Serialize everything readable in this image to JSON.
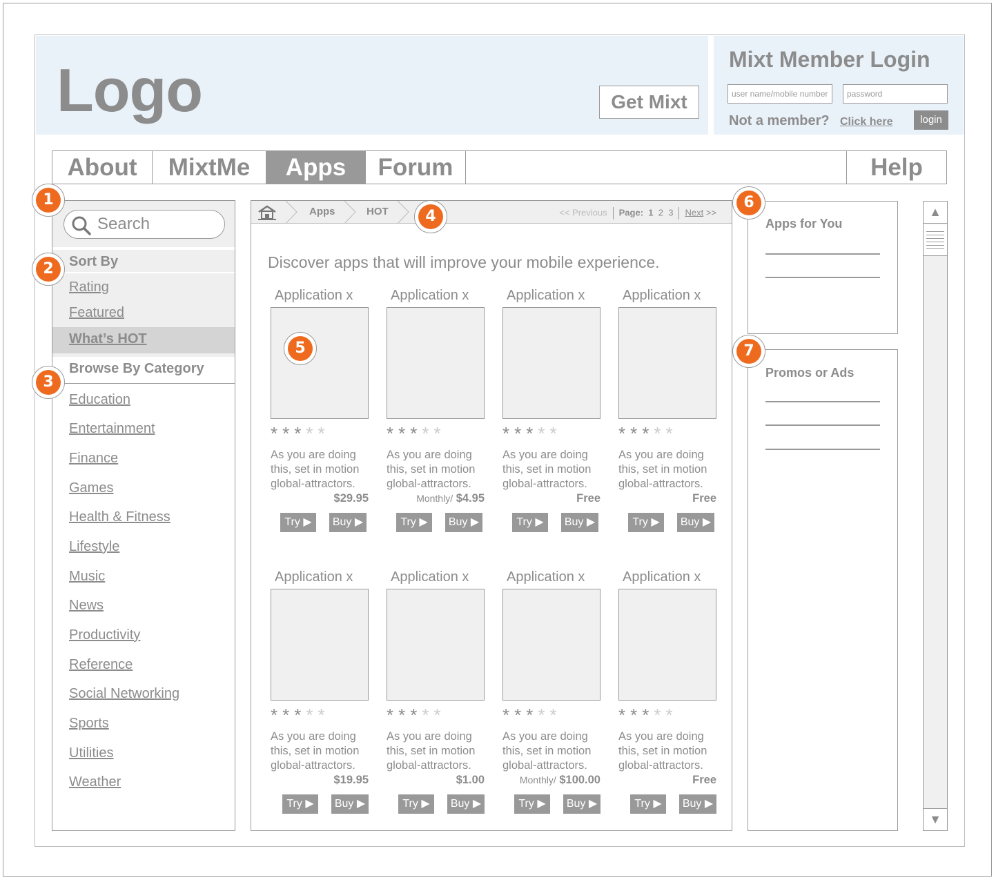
{
  "header": {
    "logo": "Logo",
    "get_mixt": "Get Mixt",
    "login_title": "Mixt Member Login",
    "username_placeholder": "user name/mobile number",
    "password_placeholder": "password",
    "not_member": "Not a member?",
    "click_here": "Click here",
    "login_button": "login"
  },
  "nav": {
    "items": [
      "About",
      "MixtMe",
      "Apps",
      "Forum"
    ],
    "active": "Apps",
    "help": "Help"
  },
  "sidebar": {
    "search_placeholder": "Search",
    "sort_title": "Sort By",
    "sort_items": [
      "Rating",
      "Featured",
      "What’s HOT"
    ],
    "browse_title": "Browse By Category",
    "categories": [
      "Education",
      "Entertainment",
      "Finance",
      "Games",
      "Health & Fitness",
      "Lifestyle",
      "Music",
      "News",
      "Productivity",
      "Reference",
      "Social Networking",
      "Sports",
      "Utilities",
      "Weather"
    ]
  },
  "main": {
    "breadcrumb": [
      "Apps",
      "HOT"
    ],
    "pager": {
      "previous": "<< Previous",
      "page_label": "Page:",
      "current": "1",
      "p2": "2",
      "p3": "3",
      "next": "Next",
      "next_arrows": ">>"
    },
    "intro": "Discover apps that will improve your mobile experience.",
    "apps": [
      {
        "name": "Application x",
        "rating": 3,
        "desc": "As you are doing this, set in motion global-attractors.",
        "price_prefix": "",
        "price": "$29.95",
        "try": "Try ▶",
        "buy": "Buy ▶"
      },
      {
        "name": "Application x",
        "rating": 3,
        "desc": "As you are doing this, set in motion global-attractors.",
        "price_prefix": "Monthly/",
        "price": "$4.95",
        "try": "Try ▶",
        "buy": "Buy ▶"
      },
      {
        "name": "Application x",
        "rating": 3,
        "desc": "As you are doing this, set in motion global-attractors.",
        "price_prefix": "",
        "price": "Free",
        "try": "Try ▶",
        "buy": "Buy ▶"
      },
      {
        "name": "Application x",
        "rating": 3,
        "desc": "As you are doing this, set in motion global-attractors.",
        "price_prefix": "",
        "price": "Free",
        "try": "Try ▶",
        "buy": "Buy ▶"
      },
      {
        "name": "Application x",
        "rating": 3,
        "desc": "As you are doing this, set in motion global-attractors.",
        "price_prefix": "",
        "price": "$19.95",
        "try": "Try ▶",
        "buy": "Buy ▶"
      },
      {
        "name": "Application x",
        "rating": 3,
        "desc": "As you are doing this, set in motion global-attractors.",
        "price_prefix": "",
        "price": "$1.00",
        "try": "Try ▶",
        "buy": "Buy ▶"
      },
      {
        "name": "Application x",
        "rating": 3,
        "desc": "As you are doing this, set in motion global-attractors.",
        "price_prefix": "Monthly/",
        "price": "$100.00",
        "try": "Try ▶",
        "buy": "Buy ▶"
      },
      {
        "name": "Application x",
        "rating": 3,
        "desc": "As you are doing this, set in motion global-attractors.",
        "price_prefix": "",
        "price": "Free",
        "try": "Try ▶",
        "buy": "Buy ▶"
      }
    ]
  },
  "right": {
    "apps_for_you": "Apps for You",
    "promos": "Promos or Ads"
  },
  "callouts": [
    "1",
    "2",
    "3",
    "4",
    "5",
    "6",
    "7"
  ],
  "colors": {
    "header_bg": "#e9f1f9",
    "callout": "#ee6a1f",
    "active_nav": "#999999"
  }
}
